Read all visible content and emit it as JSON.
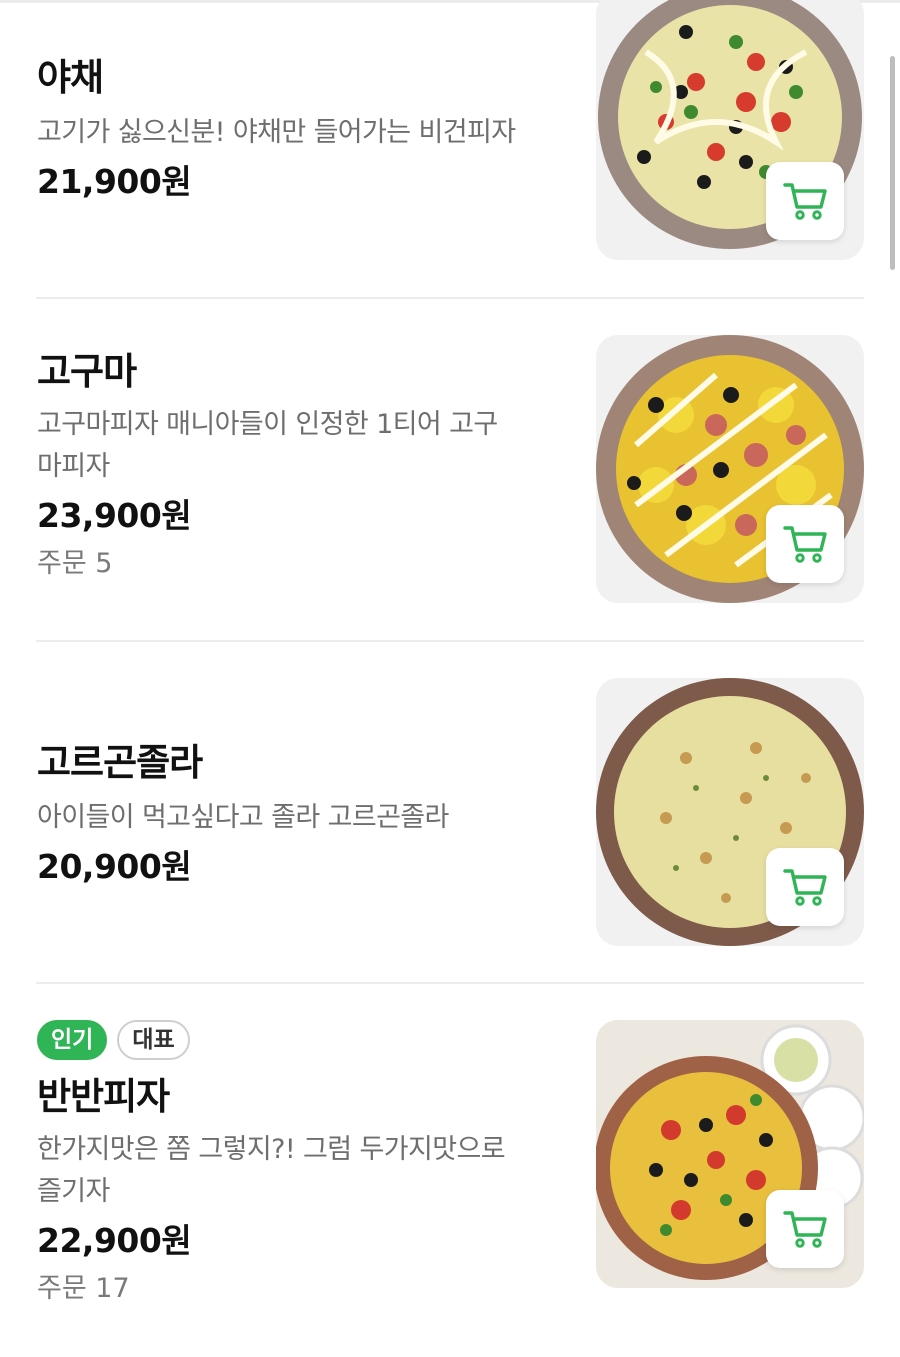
{
  "colors": {
    "accent": "#2fb456",
    "price": "#111111",
    "desc": "#6e6e6e"
  },
  "items": [
    {
      "name": "야채",
      "desc_lines": [
        "고기가 싫으신분! 야채만 들어가는 비건피자"
      ],
      "price": "21,900원",
      "orders": "",
      "badges": [],
      "cart_icon": "cart-icon"
    },
    {
      "name": "고구마",
      "desc_lines": [
        "고구마피자 매니아들이 인정한 1티어 고구",
        "마피자"
      ],
      "price": "23,900원",
      "orders": "주문 5",
      "badges": [],
      "cart_icon": "cart-icon"
    },
    {
      "name": "고르곤졸라",
      "desc_lines": [
        "아이들이 먹고싶다고 졸라 고르곤졸라"
      ],
      "price": "20,900원",
      "orders": "",
      "badges": [],
      "cart_icon": "cart-icon"
    },
    {
      "name": "반반피자",
      "desc_lines": [
        "한가지맛은 쫌 그렇지?! 그럼 두가지맛으로",
        "즐기자"
      ],
      "price": "22,900원",
      "orders": "주문 17",
      "badges": [
        "인기",
        "대표"
      ],
      "cart_icon": "cart-icon"
    }
  ]
}
